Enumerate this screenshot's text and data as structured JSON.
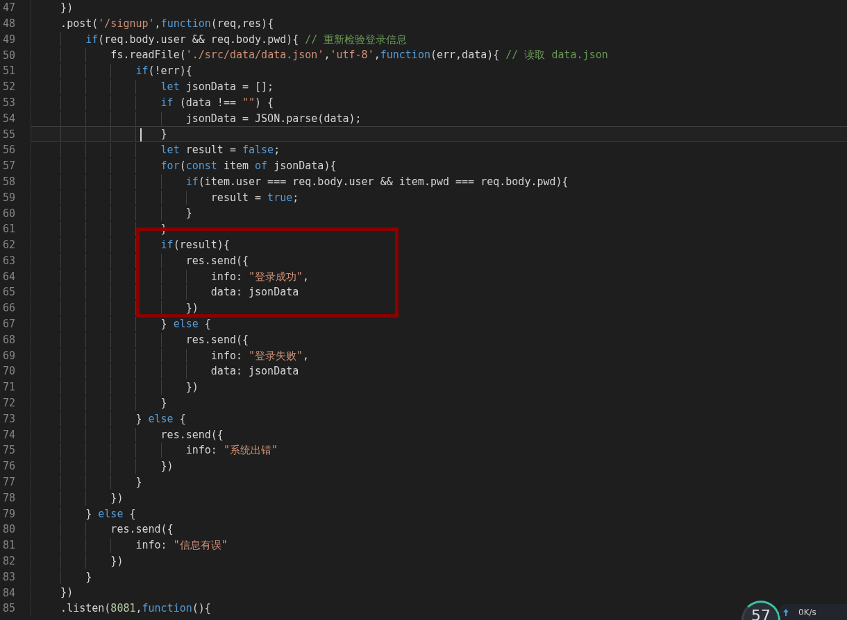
{
  "editor": {
    "lines": [
      {
        "number": "47",
        "current": false,
        "tokens": [
          {
            "kind": "plain",
            "text": "    })"
          }
        ]
      },
      {
        "number": "48",
        "current": false,
        "tokens": [
          {
            "kind": "plain",
            "text": "    .post("
          },
          {
            "kind": "string",
            "text": "'/signup'"
          },
          {
            "kind": "plain",
            "text": ","
          },
          {
            "kind": "keyword",
            "text": "function"
          },
          {
            "kind": "plain",
            "text": "(req,res){"
          }
        ]
      },
      {
        "number": "49",
        "current": false,
        "tokens": [
          {
            "kind": "keyword",
            "text": "        if"
          },
          {
            "kind": "plain",
            "text": "(req.body.user && req.body.pwd){ "
          },
          {
            "kind": "comment",
            "text": "// 重新检验登录信息"
          }
        ]
      },
      {
        "number": "50",
        "current": false,
        "tokens": [
          {
            "kind": "plain",
            "text": "            fs.readFile("
          },
          {
            "kind": "string",
            "text": "'./src/data/data.json'"
          },
          {
            "kind": "plain",
            "text": ","
          },
          {
            "kind": "string",
            "text": "'utf-8'"
          },
          {
            "kind": "plain",
            "text": ","
          },
          {
            "kind": "keyword",
            "text": "function"
          },
          {
            "kind": "plain",
            "text": "(err,data){ "
          },
          {
            "kind": "comment",
            "text": "// 读取 data.json"
          }
        ]
      },
      {
        "number": "51",
        "current": false,
        "tokens": [
          {
            "kind": "keyword",
            "text": "                if"
          },
          {
            "kind": "plain",
            "text": "(!err){"
          }
        ]
      },
      {
        "number": "52",
        "current": false,
        "tokens": [
          {
            "kind": "keyword",
            "text": "                    let"
          },
          {
            "kind": "plain",
            "text": " jsonData = [];"
          }
        ]
      },
      {
        "number": "53",
        "current": false,
        "tokens": [
          {
            "kind": "keyword",
            "text": "                    if"
          },
          {
            "kind": "plain",
            "text": " (data !== "
          },
          {
            "kind": "string",
            "text": "\"\""
          },
          {
            "kind": "plain",
            "text": ") {"
          }
        ]
      },
      {
        "number": "54",
        "current": false,
        "tokens": [
          {
            "kind": "plain",
            "text": "                        jsonData = JSON.parse(data);"
          }
        ]
      },
      {
        "number": "55",
        "current": true,
        "tokens": [
          {
            "kind": "plain",
            "text": "                    }"
          }
        ]
      },
      {
        "number": "56",
        "current": false,
        "tokens": [
          {
            "kind": "keyword",
            "text": "                    let"
          },
          {
            "kind": "plain",
            "text": " result = "
          },
          {
            "kind": "keyword",
            "text": "false"
          },
          {
            "kind": "plain",
            "text": ";"
          }
        ]
      },
      {
        "number": "57",
        "current": false,
        "tokens": [
          {
            "kind": "keyword",
            "text": "                    for"
          },
          {
            "kind": "plain",
            "text": "("
          },
          {
            "kind": "keyword",
            "text": "const"
          },
          {
            "kind": "plain",
            "text": " item "
          },
          {
            "kind": "keyword",
            "text": "of"
          },
          {
            "kind": "plain",
            "text": " jsonData){"
          }
        ]
      },
      {
        "number": "58",
        "current": false,
        "tokens": [
          {
            "kind": "keyword",
            "text": "                        if"
          },
          {
            "kind": "plain",
            "text": "(item.user === req.body.user && item.pwd === req.body.pwd){"
          }
        ]
      },
      {
        "number": "59",
        "current": false,
        "tokens": [
          {
            "kind": "plain",
            "text": "                            result = "
          },
          {
            "kind": "keyword",
            "text": "true"
          },
          {
            "kind": "plain",
            "text": ";"
          }
        ]
      },
      {
        "number": "60",
        "current": false,
        "tokens": [
          {
            "kind": "plain",
            "text": "                        }"
          }
        ]
      },
      {
        "number": "61",
        "current": false,
        "tokens": [
          {
            "kind": "plain",
            "text": "                    }"
          }
        ]
      },
      {
        "number": "62",
        "current": false,
        "tokens": [
          {
            "kind": "keyword",
            "text": "                    if"
          },
          {
            "kind": "plain",
            "text": "(result){"
          }
        ]
      },
      {
        "number": "63",
        "current": false,
        "tokens": [
          {
            "kind": "plain",
            "text": "                        res.send({"
          }
        ]
      },
      {
        "number": "64",
        "current": false,
        "tokens": [
          {
            "kind": "plain",
            "text": "                            info: "
          },
          {
            "kind": "string",
            "text": "\"登录成功\""
          },
          {
            "kind": "plain",
            "text": ","
          }
        ]
      },
      {
        "number": "65",
        "current": false,
        "tokens": [
          {
            "kind": "plain",
            "text": "                            data: jsonData"
          }
        ]
      },
      {
        "number": "66",
        "current": false,
        "tokens": [
          {
            "kind": "plain",
            "text": "                        })"
          }
        ]
      },
      {
        "number": "67",
        "current": false,
        "tokens": [
          {
            "kind": "plain",
            "text": "                    } "
          },
          {
            "kind": "keyword",
            "text": "else"
          },
          {
            "kind": "plain",
            "text": " {"
          }
        ]
      },
      {
        "number": "68",
        "current": false,
        "tokens": [
          {
            "kind": "plain",
            "text": "                        res.send({"
          }
        ]
      },
      {
        "number": "69",
        "current": false,
        "tokens": [
          {
            "kind": "plain",
            "text": "                            info: "
          },
          {
            "kind": "string",
            "text": "\"登录失败\""
          },
          {
            "kind": "plain",
            "text": ","
          }
        ]
      },
      {
        "number": "70",
        "current": false,
        "tokens": [
          {
            "kind": "plain",
            "text": "                            data: jsonData"
          }
        ]
      },
      {
        "number": "71",
        "current": false,
        "tokens": [
          {
            "kind": "plain",
            "text": "                        })"
          }
        ]
      },
      {
        "number": "72",
        "current": false,
        "tokens": [
          {
            "kind": "plain",
            "text": "                    }"
          }
        ]
      },
      {
        "number": "73",
        "current": false,
        "tokens": [
          {
            "kind": "plain",
            "text": "                } "
          },
          {
            "kind": "keyword",
            "text": "else"
          },
          {
            "kind": "plain",
            "text": " {"
          }
        ]
      },
      {
        "number": "74",
        "current": false,
        "tokens": [
          {
            "kind": "plain",
            "text": "                    res.send({"
          }
        ]
      },
      {
        "number": "75",
        "current": false,
        "tokens": [
          {
            "kind": "plain",
            "text": "                        info: "
          },
          {
            "kind": "string",
            "text": "\"系统出错\""
          }
        ]
      },
      {
        "number": "76",
        "current": false,
        "tokens": [
          {
            "kind": "plain",
            "text": "                    })"
          }
        ]
      },
      {
        "number": "77",
        "current": false,
        "tokens": [
          {
            "kind": "plain",
            "text": "                }"
          }
        ]
      },
      {
        "number": "78",
        "current": false,
        "tokens": [
          {
            "kind": "plain",
            "text": "            })"
          }
        ]
      },
      {
        "number": "79",
        "current": false,
        "tokens": [
          {
            "kind": "plain",
            "text": "        } "
          },
          {
            "kind": "keyword",
            "text": "else"
          },
          {
            "kind": "plain",
            "text": " {"
          }
        ]
      },
      {
        "number": "80",
        "current": false,
        "tokens": [
          {
            "kind": "plain",
            "text": "            res.send({"
          }
        ]
      },
      {
        "number": "81",
        "current": false,
        "tokens": [
          {
            "kind": "plain",
            "text": "                info: "
          },
          {
            "kind": "string",
            "text": "\"信息有误\""
          }
        ]
      },
      {
        "number": "82",
        "current": false,
        "tokens": [
          {
            "kind": "plain",
            "text": "            })"
          }
        ]
      },
      {
        "number": "83",
        "current": false,
        "tokens": [
          {
            "kind": "plain",
            "text": "        }"
          }
        ]
      },
      {
        "number": "84",
        "current": false,
        "tokens": [
          {
            "kind": "plain",
            "text": "    })"
          }
        ]
      },
      {
        "number": "85",
        "current": false,
        "tokens": [
          {
            "kind": "plain",
            "text": "    .listen("
          },
          {
            "kind": "number",
            "text": "8081"
          },
          {
            "kind": "plain",
            "text": ","
          },
          {
            "kind": "keyword",
            "text": "function"
          },
          {
            "kind": "plain",
            "text": "(){"
          }
        ]
      }
    ]
  },
  "speed_widget": {
    "value": "57",
    "upload": "0K/s"
  }
}
